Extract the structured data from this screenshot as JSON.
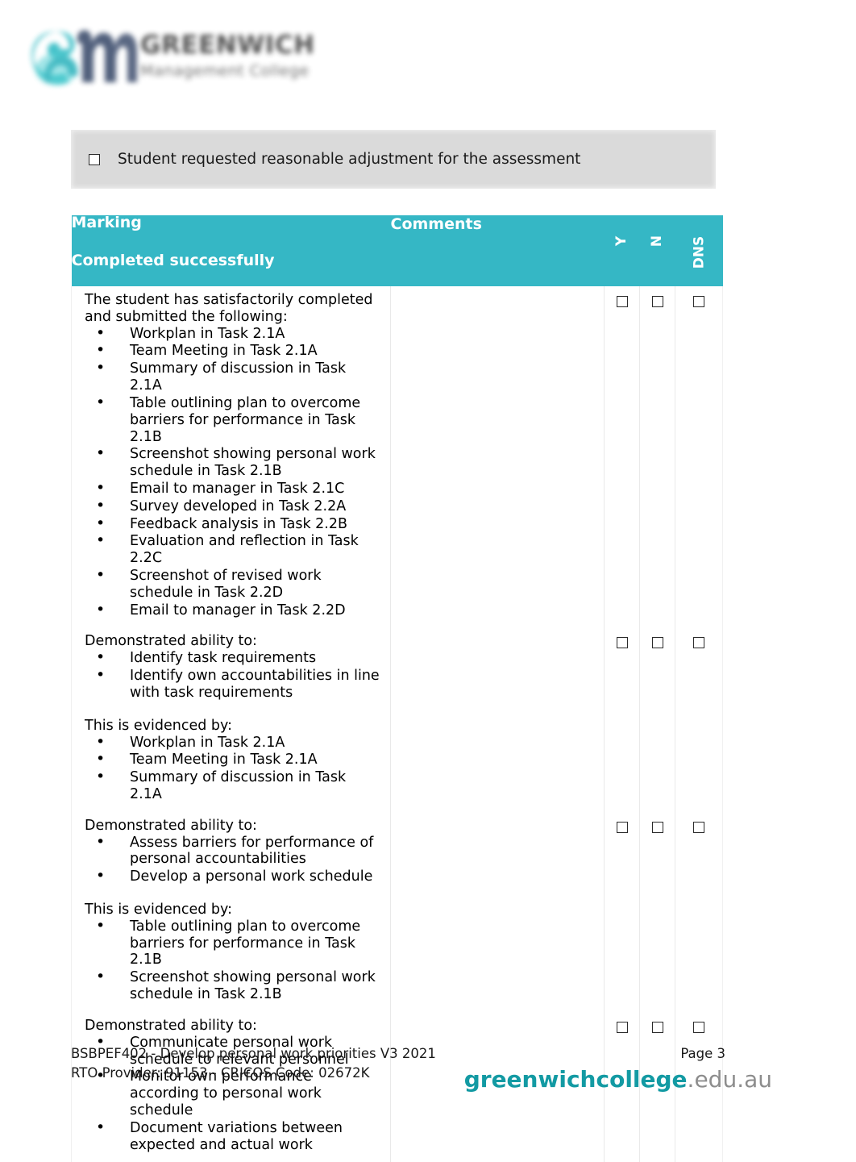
{
  "logo": {
    "mark_icon": "greenwich-gm-monogram-icon",
    "name": "GREENWICH",
    "subtitle": "Management College",
    "colors": {
      "teal": "#3fc0c8",
      "navy": "#4a5a77"
    }
  },
  "adjustment": {
    "checkbox_icon": "empty-checkbox-icon",
    "label": "Student requested reasonable adjustment for the assessment",
    "background": "#dadada"
  },
  "table": {
    "accent_color": "#35b7c5",
    "header": {
      "marking": "Marking",
      "marking_sub": "Completed successfully",
      "comments": "Comments",
      "y": "Y",
      "n": "N",
      "dns": "DNS"
    },
    "rows": [
      {
        "lead": "The student has satisfactorily completed and submitted the following:",
        "bullets": [
          "Workplan in Task 2.1A",
          "Team Meeting in Task 2.1A",
          "Summary of discussion in Task 2.1A",
          "Table outlining plan to overcome barriers for performance in Task 2.1B",
          "Screenshot showing personal work schedule in Task 2.1B",
          "Email to manager in Task 2.1C",
          "Survey developed in Task 2.2A",
          "Feedback analysis in Task 2.2B",
          "Evaluation and reflection in Task 2.2C",
          "Screenshot of revised work schedule in Task 2.2D",
          "Email to manager in Task 2.2D"
        ],
        "lead2": "",
        "bullets2": [],
        "comments": "",
        "y_checked": false,
        "n_checked": false,
        "dns_checked": false
      },
      {
        "lead": "Demonstrated ability to:",
        "bullets": [
          "Identify task requirements",
          "Identify own accountabilities in line with task requirements"
        ],
        "lead2": "This is evidenced by:",
        "bullets2": [
          "Workplan in Task 2.1A",
          "Team Meeting in Task 2.1A",
          "Summary of discussion in Task 2.1A"
        ],
        "comments": "",
        "y_checked": false,
        "n_checked": false,
        "dns_checked": false
      },
      {
        "lead": "Demonstrated ability to:",
        "bullets": [
          "Assess barriers for performance of personal accountabilities",
          "Develop a personal work schedule"
        ],
        "lead2": "This is evidenced by:",
        "bullets2": [
          "Table outlining plan to overcome barriers for performance in Task 2.1B",
          "Screenshot showing personal work schedule in Task 2.1B"
        ],
        "comments": "",
        "y_checked": false,
        "n_checked": false,
        "dns_checked": false
      },
      {
        "lead": "Demonstrated ability to:",
        "bullets": [
          "Communicate personal work schedule to relevant personnel",
          "Monitor own performance according to personal work schedule",
          "Document variations between expected and actual work"
        ],
        "lead2": "",
        "bullets2": [],
        "comments": "",
        "y_checked": false,
        "n_checked": false,
        "dns_checked": false
      }
    ]
  },
  "footer": {
    "line1": "BSBPEF402 - Develop personal work priorities V3 2021",
    "line2": "RTO Provider: 91153  - CRICOS  Code: 02672K",
    "page": "Page 3",
    "url_bold": "greenwichcollege",
    "url_tail": ".edu.au",
    "url_color": "#139aa3"
  }
}
